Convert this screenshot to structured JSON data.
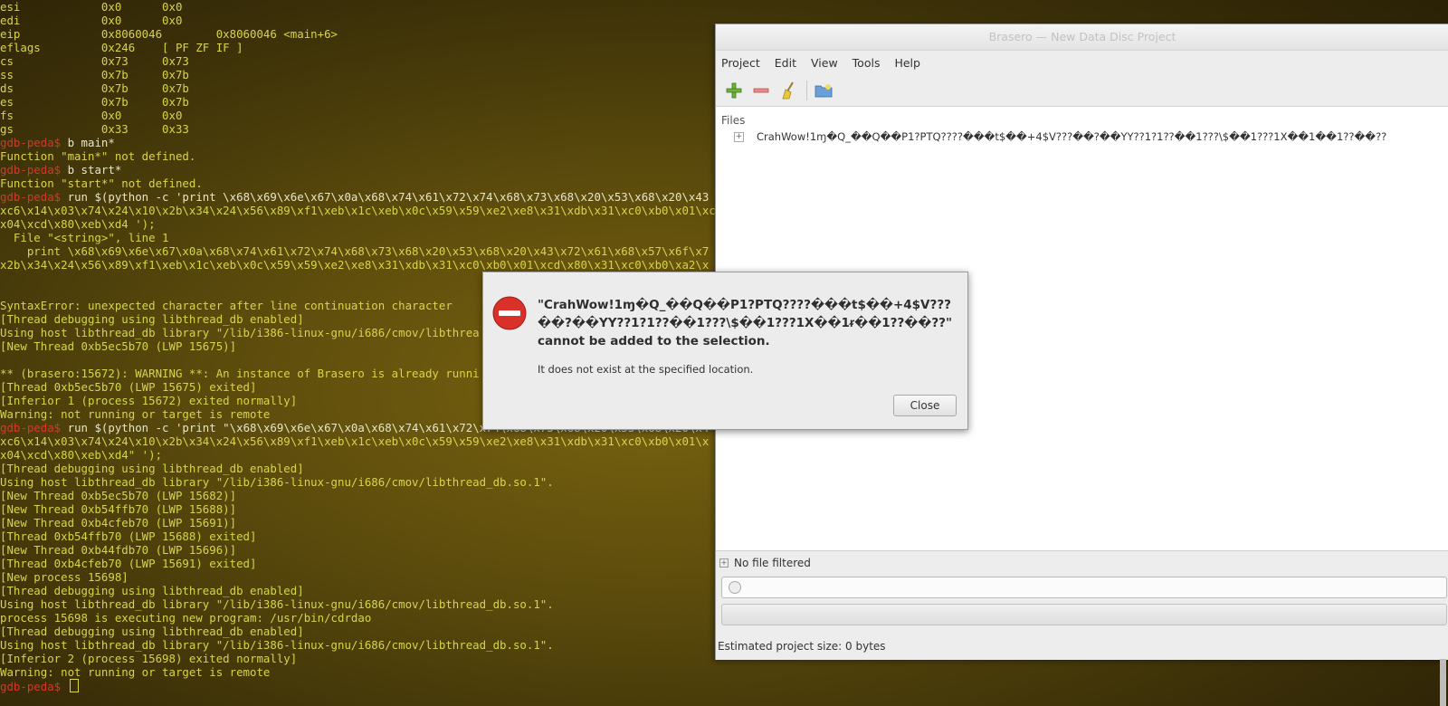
{
  "terminal": {
    "lines": [
      {
        "kind": "yellow",
        "text": "esi            0x0      0x0"
      },
      {
        "kind": "yellow",
        "text": "edi            0x0      0x0"
      },
      {
        "kind": "yellow",
        "text": "eip            0x8060046        0x8060046 <main+6>"
      },
      {
        "kind": "yellow",
        "text": "eflags         0x246    [ PF ZF IF ]"
      },
      {
        "kind": "yellow",
        "text": "cs             0x73     0x73"
      },
      {
        "kind": "yellow",
        "text": "ss             0x7b     0x7b"
      },
      {
        "kind": "yellow",
        "text": "ds             0x7b     0x7b"
      },
      {
        "kind": "yellow",
        "text": "es             0x7b     0x7b"
      },
      {
        "kind": "yellow",
        "text": "fs             0x0      0x0"
      },
      {
        "kind": "yellow",
        "text": "gs             0x33     0x33"
      },
      {
        "kind": "prompt",
        "prompt": "gdb-peda$ ",
        "text": "b main*"
      },
      {
        "kind": "yellow",
        "text": "Function \"main*\" not defined."
      },
      {
        "kind": "prompt",
        "prompt": "gdb-peda$ ",
        "text": "b start*"
      },
      {
        "kind": "yellow",
        "text": "Function \"start*\" not defined."
      },
      {
        "kind": "prompt",
        "prompt": "gdb-peda$ ",
        "text": "run $(python -c 'print \\x68\\x69\\x6e\\x67\\x0a\\x68\\x74\\x61\\x72\\x74\\x68\\x73\\x68\\x20\\x53\\x68\\x20\\x43"
      },
      {
        "kind": "yellow",
        "text": "xc6\\x14\\x03\\x74\\x24\\x10\\x2b\\x34\\x24\\x56\\x89\\xf1\\xeb\\x1c\\xeb\\x0c\\x59\\x59\\xe2\\xe8\\x31\\xdb\\x31\\xc0\\xb0\\x01\\xcd"
      },
      {
        "kind": "yellow",
        "text": "x04\\xcd\\x80\\xeb\\xd4 ');"
      },
      {
        "kind": "yellow",
        "text": "  File \"<string>\", line 1"
      },
      {
        "kind": "yellow",
        "text": "    print \\x68\\x69\\x6e\\x67\\x0a\\x68\\x74\\x61\\x72\\x74\\x68\\x73\\x68\\x20\\x53\\x68\\x20\\x43\\x72\\x61\\x68\\x57\\x6f\\x7"
      },
      {
        "kind": "yellow",
        "text": "x2b\\x34\\x24\\x56\\x89\\xf1\\xeb\\x1c\\xeb\\x0c\\x59\\x59\\xe2\\xe8\\x31\\xdb\\x31\\xc0\\xb0\\x01\\xcd\\x80\\x31\\xc0\\xb0\\xa2\\x"
      },
      {
        "kind": "yellow",
        "text": ""
      },
      {
        "kind": "yellow",
        "text": ""
      },
      {
        "kind": "yellow",
        "text": "SyntaxError: unexpected character after line continuation character"
      },
      {
        "kind": "yellow",
        "text": "[Thread debugging using libthread_db enabled]"
      },
      {
        "kind": "yellow",
        "text": "Using host libthread_db library \"/lib/i386-linux-gnu/i686/cmov/libthrea"
      },
      {
        "kind": "yellow",
        "text": "[New Thread 0xb5ec5b70 (LWP 15675)]"
      },
      {
        "kind": "yellow",
        "text": ""
      },
      {
        "kind": "yellow",
        "text": "** (brasero:15672): WARNING **: An instance of Brasero is already runni"
      },
      {
        "kind": "yellow",
        "text": "[Thread 0xb5ec5b70 (LWP 15675) exited]"
      },
      {
        "kind": "yellow",
        "text": "[Inferior 1 (process 15672) exited normally]"
      },
      {
        "kind": "yellow",
        "text": "Warning: not running or target is remote"
      },
      {
        "kind": "prompt",
        "prompt": "gdb-peda$ ",
        "text": "run $(python -c 'print \"\\x68\\x69\\x6e\\x67\\x0a\\x68\\x74\\x61\\x72\\x74\\x68\\x73\\x68\\x20\\x53\\x68\\x20\\x4"
      },
      {
        "kind": "yellow",
        "text": "xc6\\x14\\x03\\x74\\x24\\x10\\x2b\\x34\\x24\\x56\\x89\\xf1\\xeb\\x1c\\xeb\\x0c\\x59\\x59\\xe2\\xe8\\x31\\xdb\\x31\\xc0\\xb0\\x01\\x"
      },
      {
        "kind": "yellow",
        "text": "x04\\xcd\\x80\\xeb\\xd4\" ');"
      },
      {
        "kind": "yellow",
        "text": "[Thread debugging using libthread_db enabled]"
      },
      {
        "kind": "yellow",
        "text": "Using host libthread_db library \"/lib/i386-linux-gnu/i686/cmov/libthread_db.so.1\"."
      },
      {
        "kind": "yellow",
        "text": "[New Thread 0xb5ec5b70 (LWP 15682)]"
      },
      {
        "kind": "yellow",
        "text": "[New Thread 0xb54ffb70 (LWP 15688)]"
      },
      {
        "kind": "yellow",
        "text": "[New Thread 0xb4cfeb70 (LWP 15691)]"
      },
      {
        "kind": "yellow",
        "text": "[Thread 0xb54ffb70 (LWP 15688) exited]"
      },
      {
        "kind": "yellow",
        "text": "[New Thread 0xb44fdb70 (LWP 15696)]"
      },
      {
        "kind": "yellow",
        "text": "[Thread 0xb4cfeb70 (LWP 15691) exited]"
      },
      {
        "kind": "yellow",
        "text": "[New process 15698]"
      },
      {
        "kind": "yellow",
        "text": "[Thread debugging using libthread_db enabled]"
      },
      {
        "kind": "yellow",
        "text": "Using host libthread_db library \"/lib/i386-linux-gnu/i686/cmov/libthread_db.so.1\"."
      },
      {
        "kind": "yellow",
        "text": "process 15698 is executing new program: /usr/bin/cdrdao"
      },
      {
        "kind": "yellow",
        "text": "[Thread debugging using libthread_db enabled]"
      },
      {
        "kind": "yellow",
        "text": "Using host libthread_db library \"/lib/i386-linux-gnu/i686/cmov/libthread_db.so.1\"."
      },
      {
        "kind": "yellow",
        "text": "[Inferior 2 (process 15698) exited normally]"
      },
      {
        "kind": "yellow",
        "text": "Warning: not running or target is remote"
      },
      {
        "kind": "prompt",
        "prompt": "gdb-peda$ ",
        "text": "",
        "cursor": true
      }
    ]
  },
  "brasero": {
    "title": "Brasero — New Data Disc Project",
    "menu": [
      "Project",
      "Edit",
      "View",
      "Tools",
      "Help"
    ],
    "toolbar_icons": [
      "add-icon",
      "remove-icon",
      "broom-icon",
      "folder-icon"
    ],
    "files_header": "Files",
    "file_name": "CrahWow!1ɱ�Q_��Q��P1?PTQ????���t$��+4$V???��?��YY??1?1??��1???\\$��1???1X��1��1??��??",
    "filter_label": "No file filtered",
    "status": "Estimated project size: 0 bytes"
  },
  "dialog": {
    "primary": "\"CrahWow!1ɱ�Q_��Q��P1?PTQ????���t$��+4$V???��?��YY??1?1??��1???\\$��1???1X��1ᵲ��1??��??\" cannot be added to the selection.",
    "secondary": "It does not exist at the specified location.",
    "close_label": "Close"
  },
  "colors": {
    "terminal_text": "#d9d44a",
    "prompt": "#d8362c",
    "error_red": "#d9302a"
  }
}
